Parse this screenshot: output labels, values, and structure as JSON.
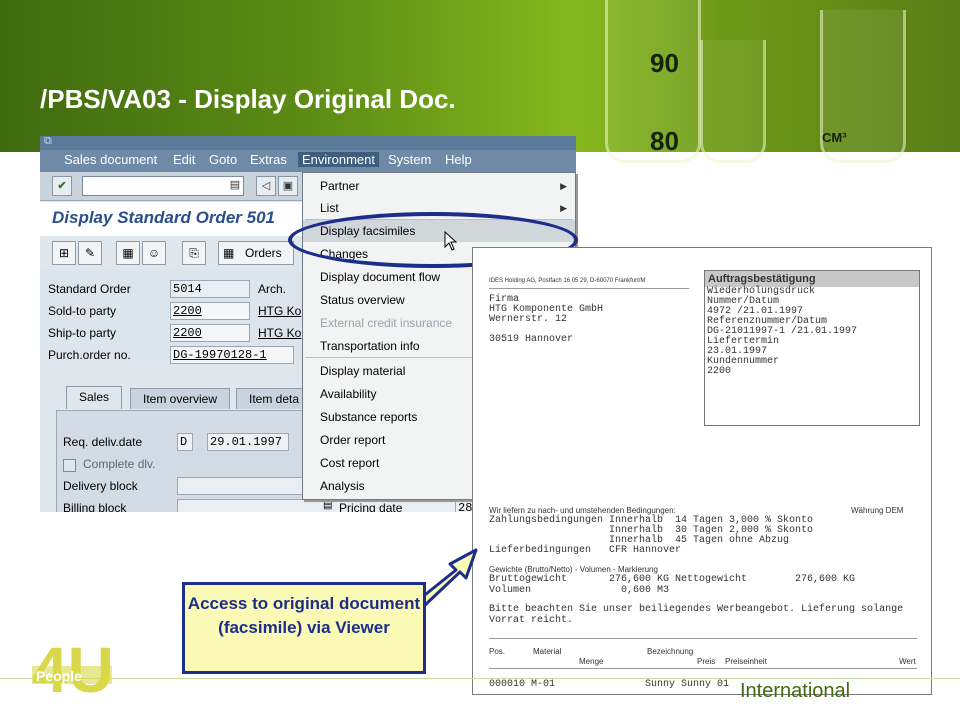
{
  "slide": {
    "title": "/PBS/VA03 - Display Original Doc.",
    "callout_text": "Access to original document (facsimile) via Viewer",
    "footer_text": "International",
    "logo_text": "People",
    "logo_mark": "4U",
    "glass_labels": [
      "90",
      "80",
      "CM³"
    ]
  },
  "menubar": {
    "items": [
      "Sales document",
      "Edit",
      "Goto",
      "Extras",
      "Environment",
      "System",
      "Help"
    ],
    "active": "Environment"
  },
  "header": {
    "title": "Display Standard Order 501"
  },
  "toolbar": {
    "orders_label": "Orders"
  },
  "fields": {
    "standard_order": {
      "label": "Standard Order",
      "value": "5014",
      "extra": "Arch."
    },
    "sold_to": {
      "label": "Sold-to party",
      "value": "2200",
      "extra": "HTG Ko"
    },
    "ship_to": {
      "label": "Ship-to party",
      "value": "2200",
      "extra": "HTG Ko"
    },
    "purch_order": {
      "label": "Purch.order no.",
      "value": "DG-19970128-1"
    }
  },
  "tabs": [
    "Sales",
    "Item overview",
    "Item deta"
  ],
  "sales_tab": {
    "req_deliv_label": "Req. deliv.date",
    "req_deliv_type": "D",
    "req_deliv_date": "29.01.1997",
    "complete_dlv_label": "Complete dlv.",
    "delivery_block_label": "Delivery block",
    "billing_block_label": "Billing block",
    "pricing_date_label": "Pricing date",
    "pricing_date_value": "28"
  },
  "environment_menu": {
    "items": [
      {
        "label": "Partner",
        "submenu": true
      },
      {
        "label": "List",
        "submenu": true
      },
      {
        "label": "Display facsimiles",
        "highlighted": true
      },
      {
        "label": "Changes"
      },
      {
        "label": "Display document flow"
      },
      {
        "label": "Status overview"
      },
      {
        "label": "External credit insurance",
        "disabled": true
      },
      {
        "label": "Transportation info"
      },
      {
        "label": "Display material"
      },
      {
        "label": "Availability"
      },
      {
        "label": "Substance reports"
      },
      {
        "label": "Order report"
      },
      {
        "label": "Cost report"
      },
      {
        "label": "Analysis"
      }
    ]
  },
  "facsimile": {
    "sender_line": "IDES Holding AG, Postfach 16 05 29, D-60070 Frankfurt/M",
    "address": [
      "Firma",
      "HTG Komponente GmbH",
      "Wernerstr. 12",
      "",
      "30519 Hannover"
    ],
    "box_title": "Auftragsbestätigung",
    "box_lines": [
      "Wiederholungsdruck",
      "Nummer/Datum",
      "4972 /21.01.1997",
      "Referenznummer/Datum",
      "DG-21011997-1 /21.01.1997",
      "Liefertermin",
      "23.01.1997",
      "Kundennummer",
      "2200"
    ],
    "conditions_intro": "Wir liefern zu nach- und umstehenden Bedingungen:",
    "currency_label": "Währung DEM",
    "payment_lines": [
      "Zahlungsbedingungen Innerhalb  14 Tagen 3,000 % Skonto",
      "                    Innerhalb  30 Tagen 2,000 % Skonto",
      "                    Innerhalb  45 Tagen ohne Abzug",
      "Lieferbedingungen   CFR Hannover"
    ],
    "weights_heading": "Gewichte (Brutto/Netto) - Volumen - Markierung",
    "weights_lines": [
      "Bruttogewicht       276,600 KG Nettogewicht        276,600 KG",
      "Volumen               0,600 M3"
    ],
    "notice_lines": [
      "Bitte beachten Sie unser beiliegendes Werbeangebot. Lieferung solange",
      "Vorrat reicht."
    ],
    "table_head_1": [
      "Pos.",
      "Material",
      "Bezeichnung"
    ],
    "table_head_2": [
      "Menge",
      "Preis",
      "Preiseinheit",
      "Wert"
    ],
    "first_row": "000010 M-01               Sunny Sunny 01"
  }
}
